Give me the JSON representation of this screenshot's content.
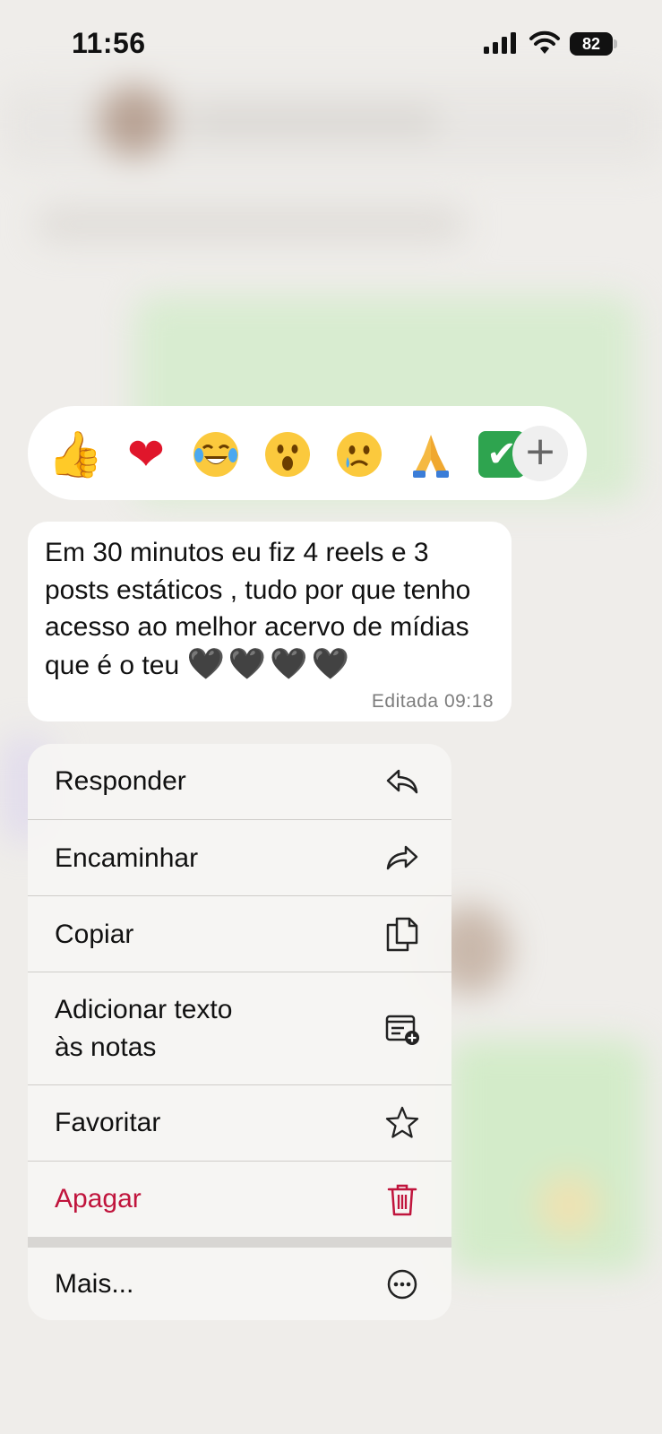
{
  "status_bar": {
    "time": "11:56",
    "battery_level": "82"
  },
  "reactions": {
    "emojis": [
      {
        "icon": "thumbs-up",
        "glyph": "👍"
      },
      {
        "icon": "red-heart",
        "glyph": "❤"
      },
      {
        "icon": "face-with-tears-of-joy",
        "glyph": "😂"
      },
      {
        "icon": "face-with-open-mouth",
        "glyph": "😮"
      },
      {
        "icon": "crying-face",
        "glyph": "😢"
      },
      {
        "icon": "folded-hands",
        "glyph": "🙏"
      },
      {
        "icon": "check-mark-button",
        "glyph": "✔"
      }
    ],
    "more_label": "+"
  },
  "message": {
    "text": "Em 30 minutos eu fiz 4 reels e 3 posts estáticos  , tudo por que tenho acesso ao melhor acervo de mídias que é o teu",
    "hearts": "🖤🖤🖤🖤",
    "edited_label": "Editada 09:18"
  },
  "menu": {
    "items": [
      {
        "label": "Responder",
        "icon": "reply-icon"
      },
      {
        "label": "Encaminhar",
        "icon": "forward-icon"
      },
      {
        "label": "Copiar",
        "icon": "copy-icon"
      },
      {
        "label_line1": "Adicionar texto",
        "label_line2": "às notas",
        "icon": "add-note-icon"
      },
      {
        "label": "Favoritar",
        "icon": "star-icon"
      },
      {
        "label": "Apagar",
        "icon": "trash-icon",
        "color": "#c0143c"
      },
      {
        "label": "Mais...",
        "icon": "more-icon"
      }
    ]
  },
  "colors": {
    "danger": "#c0143c",
    "bubble": "#ffffff",
    "menu_bg": "#f6f5f3",
    "background": "#efedea"
  }
}
